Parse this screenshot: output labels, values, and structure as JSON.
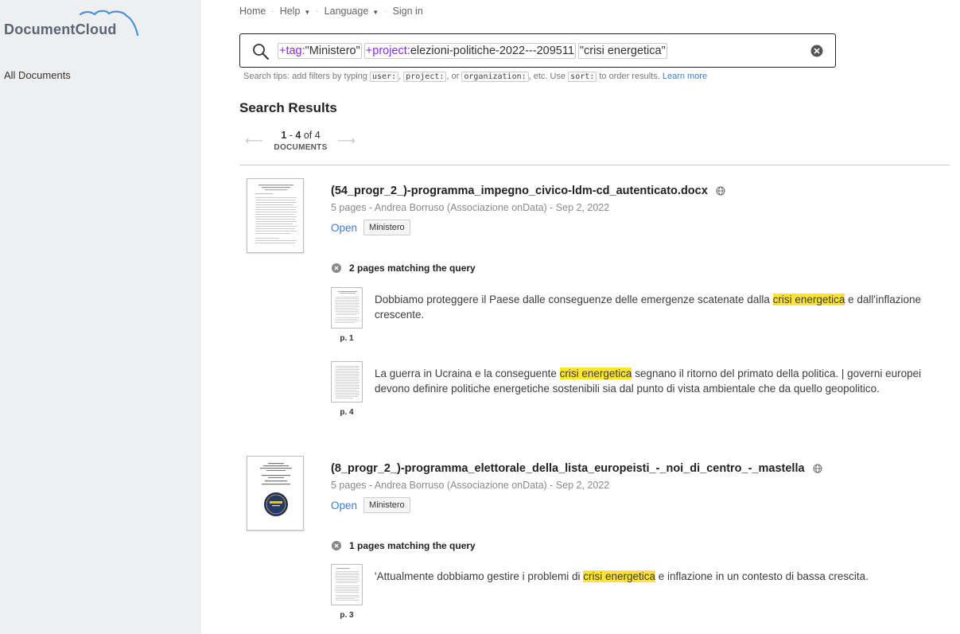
{
  "app": {
    "logo_text": "DocumentCloud"
  },
  "sidebar": {
    "items": [
      {
        "label": "All Documents"
      }
    ]
  },
  "topnav": {
    "home": "Home",
    "help": "Help",
    "language": "Language",
    "signin": "Sign in"
  },
  "search": {
    "chips": [
      {
        "key": "+tag:",
        "value": "\"Ministero\""
      },
      {
        "key": "+project:",
        "value": "elezioni-politiche-2022---209511"
      },
      {
        "key": "",
        "value": "\"crisi energetica\""
      }
    ],
    "tips": {
      "t1": "Search tips: add filters by typing",
      "c1": "user:",
      "s1": ",",
      "c2": "project:",
      "s2": ", or",
      "c3": "organization:",
      "t2": ", etc. Use",
      "c4": "sort:",
      "t3": "to order results.",
      "learn": "Learn more"
    }
  },
  "results": {
    "title": "Search Results",
    "pager": {
      "start": "1",
      "dash": " - ",
      "end": "4",
      "of": " of 4",
      "unit": "DOCUMENTS"
    }
  },
  "documents": [
    {
      "title": "(54_progr_2_)-programma_impegno_civico-ldm-cd_autenticato.docx",
      "meta": "5 pages - Andrea Borruso (Associazione onData) - Sep 2, 2022",
      "open": "Open",
      "tag": "Ministero",
      "matches_label": "2 pages matching the query",
      "hits": [
        {
          "page": "p. 1",
          "before": "Dobbiamo proteggere il Paese dalle conseguenze delle emergenze scatenate dalla ",
          "highlight": "crisi energetica",
          "after": " e dall'inflazione crescente."
        },
        {
          "page": "p. 4",
          "before": "La guerra in Ucraina e la conseguente ",
          "highlight": "crisi energetica",
          "after": " segnano il ritorno del primato della politica. | governi europei devono definire politiche energetiche sostenibili sia dal punto di vista ambientale che da quello geopolitico."
        }
      ]
    },
    {
      "title": "(8_progr_2_)-programma_elettorale_della_lista_europeisti_-_noi_di_centro_-_mastella",
      "meta": "5 pages - Andrea Borruso (Associazione onData) - Sep 2, 2022",
      "open": "Open",
      "tag": "Ministero",
      "matches_label": "1 pages matching the query",
      "hits": [
        {
          "page": "p. 3",
          "before": "'Attualmente dobbiamo gestire i problemi di ",
          "highlight": "crisi energetica",
          "after": " e inflazione in un contesto di bassa crescita."
        }
      ]
    }
  ],
  "colors": {
    "sidebar_bg": "#eeeff0",
    "link": "#3b7dd8",
    "highlight": "#ffe433",
    "filter_key": "#8a2be2"
  }
}
